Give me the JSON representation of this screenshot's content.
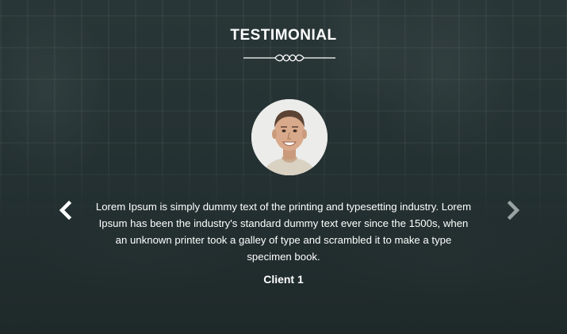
{
  "section": {
    "title": "TESTIMONIAL"
  },
  "testimonial": {
    "quote": "Lorem Ipsum is simply dummy text of the printing and typesetting industry. Lorem Ipsum has been the industry's standard dummy text ever since the 1500s, when an unknown printer took a galley of type and scrambled it to make a type specimen book.",
    "client_name": "Client 1"
  },
  "icons": {
    "prev": "chevron-left-icon",
    "next": "chevron-right-icon",
    "divider": "ornamental-divider-icon"
  },
  "colors": {
    "overlay": "#2b393a",
    "text": "#ffffff",
    "next_arrow": "#9aa3a4"
  }
}
